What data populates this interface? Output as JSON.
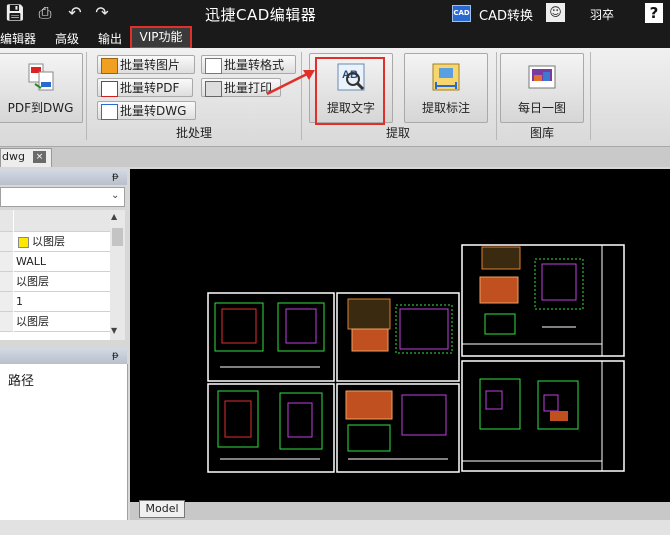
{
  "titlebar": {
    "title": "迅捷CAD编辑器",
    "cad_badge": "CAD",
    "cad_convert": "CAD转换",
    "user_name": "羽卒",
    "help": "?"
  },
  "menu": {
    "tabs": [
      "编辑器",
      "高级",
      "输出",
      "VIP功能"
    ],
    "active": "VIP功能"
  },
  "ribbon": {
    "pdf_to_dwg": "PDF到DWG",
    "batch": {
      "to_image": "批量转图片",
      "to_format": "批量转格式",
      "to_pdf": "批量转PDF",
      "print": "批量打印",
      "to_dwg": "批量转DWG",
      "group_label": "批处理"
    },
    "extract": {
      "text": "提取文字",
      "dimension": "提取标注",
      "group_label": "提取"
    },
    "library": {
      "daily": "每日一图",
      "group_label": "图库"
    }
  },
  "document": {
    "tab_label": "dwg",
    "close": "×"
  },
  "layer_panel": {
    "pin": "ᵽ",
    "rows": [
      "以图层",
      "WALL",
      "以图层",
      "1",
      "以图层"
    ]
  },
  "path_panel": {
    "pin": "ᵽ",
    "label": "路径"
  },
  "canvas": {
    "model_tab": "Model"
  },
  "colors": {
    "highlight": "#e0302a",
    "canvas_bg": "#000000"
  }
}
